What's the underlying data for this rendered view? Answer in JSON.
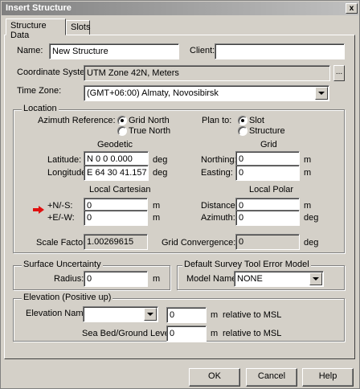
{
  "window": {
    "title": "Insert Structure",
    "close_glyph": "x"
  },
  "tabs": [
    "Structure Data",
    "Slots"
  ],
  "name_label": "Name:",
  "name_value": "New Structure",
  "client_label": "Client:",
  "client_value": "",
  "coord_label": "Coordinate System:",
  "coord_value": "UTM Zone 42N, Meters",
  "coord_button": "...",
  "tz_label": "Time Zone:",
  "tz_value": "(GMT+06:00) Almaty, Novosibirsk",
  "location": {
    "title": "Location",
    "azimuth_label": "Azimuth Reference:",
    "azimuth_options": [
      "Grid North",
      "True North"
    ],
    "plan_label": "Plan to:",
    "plan_options": [
      "Slot",
      "Structure"
    ],
    "geodetic_title": "Geodetic",
    "grid_title": "Grid",
    "latitude_label": "Latitude:",
    "latitude_value": "N 0 0 0.000",
    "longitude_label": "Longitude:",
    "longitude_value": "E 64 30 41.157",
    "deg": "deg",
    "m": "m",
    "northing_label": "Northing:",
    "northing_value": "0",
    "easting_label": "Easting:",
    "easting_value": "0",
    "local_cart_title": "Local Cartesian",
    "local_polar_title": "Local Polar",
    "ns_label": "+N/-S:",
    "ns_value": "0",
    "ew_label": "+E/-W:",
    "ew_value": "0",
    "distance_label": "Distance:",
    "distance_value": "0",
    "azimuth2_label": "Azimuth:",
    "azimuth2_value": "0",
    "scale_label": "Scale Factor:",
    "scale_value": "1.00269615",
    "gridconv_label": "Grid Convergence:",
    "gridconv_value": "0"
  },
  "surface": {
    "title": "Surface Uncertainty",
    "radius_label": "Radius:",
    "radius_value": "0",
    "m": "m"
  },
  "survey": {
    "title": "Default Survey Tool Error Model",
    "model_label": "Model Name:",
    "model_value": "NONE"
  },
  "elevation": {
    "title": "Elevation (Positive up)",
    "name_label": "Elevation Name:",
    "name_value": "",
    "elev_value": "0",
    "m": "m",
    "rel": "relative to MSL",
    "seabed_label": "Sea Bed/Ground Level:",
    "seabed_value": "0"
  },
  "buttons": {
    "ok": "OK",
    "cancel": "Cancel",
    "help": "Help"
  },
  "colors": {
    "arrow": "#e01010",
    "title_start": "#808080",
    "title_end": "#c0c0c0"
  }
}
